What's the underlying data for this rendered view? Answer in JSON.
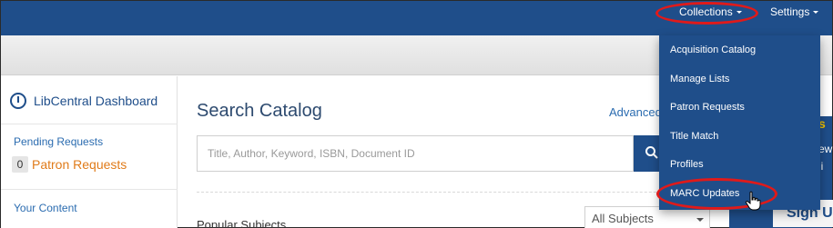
{
  "topnav": {
    "items": [
      {
        "label": "Collections"
      },
      {
        "label": "Settings"
      }
    ]
  },
  "sidebar": {
    "dashboard_label": "LibCentral Dashboard",
    "pending_label": "Pending Requests",
    "patron_count": "0",
    "patron_label": "Patron Requests",
    "content_label": "Your Content"
  },
  "main": {
    "title": "Search Catalog",
    "advanced_link": "Advanced",
    "search_placeholder": "Title, Author, Keyword, ISBN, Document ID",
    "popular_label": "Popular Subjects",
    "subjects_select_value": "All Subjects"
  },
  "dropdown": {
    "items": [
      {
        "label": "Acquisition Catalog"
      },
      {
        "label": "Manage Lists"
      },
      {
        "label": "Patron Requests"
      },
      {
        "label": "Title Match"
      },
      {
        "label": "Profiles"
      },
      {
        "label": "MARC Updates"
      }
    ]
  },
  "right_panel": {
    "text1": "s",
    "text2": "ew",
    "text3": "li",
    "signup_label": "Sign U"
  },
  "icons": {
    "dashboard": "gauge-icon",
    "search": "search-icon",
    "cursor": "hand-pointer-icon",
    "caret": "caret-down-icon"
  },
  "colors": {
    "brand": "#1f4e8a",
    "link": "#2b6cb0",
    "accent_orange": "#e07b1a",
    "highlight_red": "#e01a1a",
    "accent_yellow": "#f2c200"
  }
}
